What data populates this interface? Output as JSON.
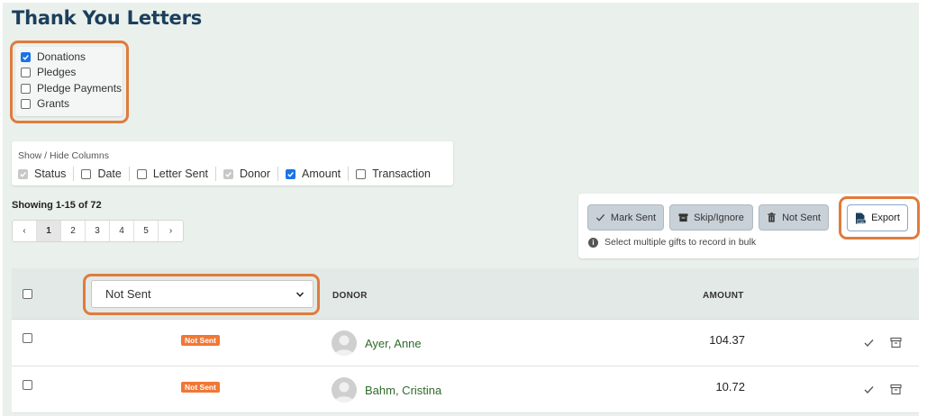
{
  "page": {
    "title": "Thank You Letters"
  },
  "gift_types": [
    {
      "label": "Donations",
      "checked": true
    },
    {
      "label": "Pledges",
      "checked": false
    },
    {
      "label": "Pledge Payments",
      "checked": false
    },
    {
      "label": "Grants",
      "checked": false
    }
  ],
  "columns": {
    "label": "Show / Hide Columns",
    "items": [
      {
        "label": "Status",
        "checked": true,
        "disabled": true
      },
      {
        "label": "Date",
        "checked": false,
        "disabled": false
      },
      {
        "label": "Letter Sent",
        "checked": false,
        "disabled": false
      },
      {
        "label": "Donor",
        "checked": true,
        "disabled": true
      },
      {
        "label": "Amount",
        "checked": true,
        "disabled": false
      },
      {
        "label": "Transaction",
        "checked": false,
        "disabled": false
      }
    ]
  },
  "pagination": {
    "showing": "Showing 1-15 of 72",
    "prev": "‹",
    "pages": [
      "1",
      "2",
      "3",
      "4",
      "5"
    ],
    "next": "›",
    "current_page": "1"
  },
  "bulk": {
    "mark_sent": "Mark Sent",
    "skip_ignore": "Skip/Ignore",
    "not_sent": "Not Sent",
    "export": "Export",
    "hint": "Select multiple gifts to record in bulk",
    "info_glyph": "i"
  },
  "table": {
    "status_filter": {
      "selected": "Not Sent"
    },
    "headers": {
      "donor": "DONOR",
      "amount": "AMOUNT"
    },
    "rows": [
      {
        "status": "Not Sent",
        "donor": "Ayer, Anne",
        "amount": "104.37"
      },
      {
        "status": "Not Sent",
        "donor": "Bahm, Cristina",
        "amount": "10.72"
      }
    ]
  },
  "colors": {
    "title": "#1b3f5c",
    "highlight": "#e07b3c",
    "badge": "#f17735",
    "donor_link": "#2f6b2a",
    "checkbox_on": "#1a73e8"
  },
  "icons": {
    "check": "check-icon",
    "archive": "archive-icon",
    "trash": "trash-icon",
    "csv": "csv-file-icon",
    "info": "info-icon",
    "chevron": "chevron-down-icon",
    "avatar": "user-avatar-icon"
  }
}
